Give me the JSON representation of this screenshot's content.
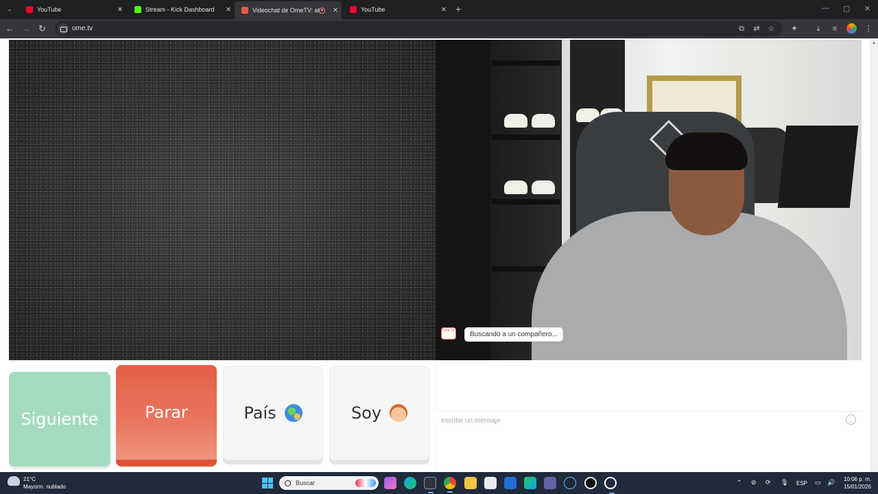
{
  "browser": {
    "tabs": [
      {
        "title": "YouTube",
        "active": false,
        "favicon_color": "#ff0033"
      },
      {
        "title": "Stream - Kick Dashboard",
        "active": false,
        "favicon_color": "#53fc18"
      },
      {
        "title": "Videochat de OmeTV: alter",
        "active": true,
        "favicon_color": "#e45a44",
        "recording": true
      },
      {
        "title": "YouTube",
        "active": false,
        "favicon_color": "#ff0033"
      }
    ],
    "url": "ome.tv"
  },
  "ometv": {
    "buttons": {
      "next": "Siguiente",
      "stop": "Parar",
      "country": "País",
      "gender": "Soy"
    },
    "chat": {
      "logo_text": "Ome TV",
      "status_message": "Buscando a un compañero...",
      "input_placeholder": "escribe un mensaje"
    }
  },
  "taskbar": {
    "weather": {
      "temp": "21°C",
      "desc": "Mayorm. nublado"
    },
    "search_placeholder": "Buscar",
    "language": "ESP",
    "time": "10:06 p. m.",
    "date": "15/01/2026"
  },
  "colors": {
    "next_button": "#a4dbc0",
    "stop_button": "#e55f47",
    "brand": "#e45a44"
  }
}
